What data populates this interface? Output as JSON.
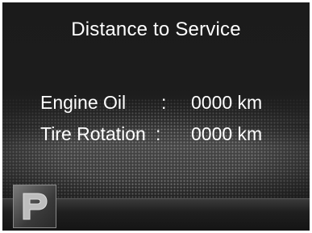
{
  "screen": {
    "title": "Distance to Service",
    "rows": [
      {
        "label": "Engine Oil",
        "separator": ":",
        "value": "0000 km"
      },
      {
        "label": "Tire Rotation",
        "separator": ":",
        "value": "0000 km"
      }
    ]
  },
  "indicator": {
    "icon": "park-p-icon"
  }
}
